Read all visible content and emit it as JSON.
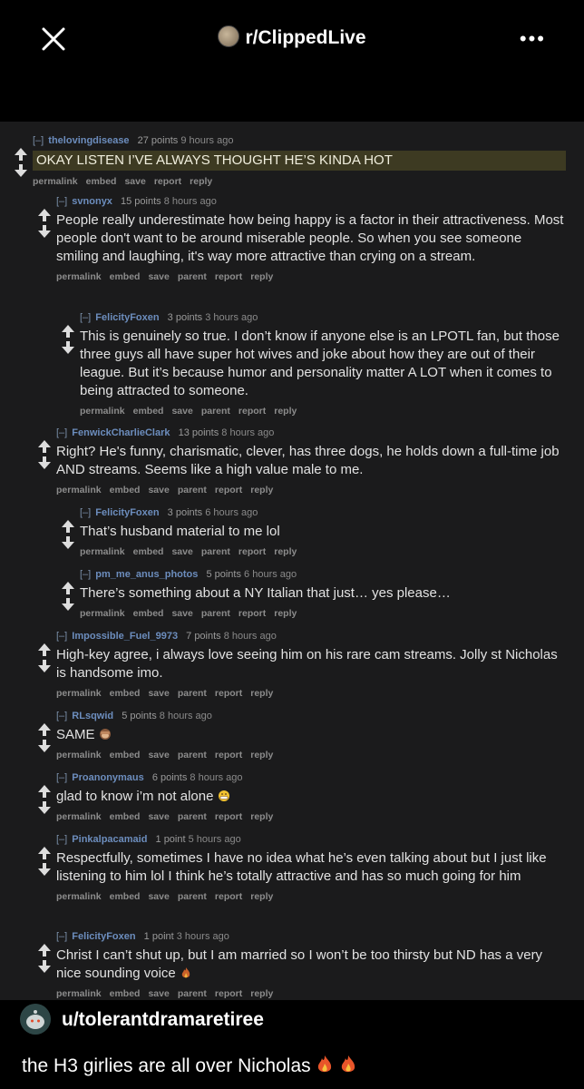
{
  "header": {
    "subreddit": "r/ClippedLive",
    "more": "•••"
  },
  "comments": [
    {
      "author": "thelovingdisease",
      "score": "27 points",
      "time": "9 hours ago",
      "text": "OKAY LISTEN I’VE ALWAYS THOUGHT HE’S KINDA HOT",
      "links": [
        "permalink",
        "embed",
        "save",
        "report",
        "reply"
      ]
    },
    {
      "author": "svnonyx",
      "score": "15 points",
      "time": "8 hours ago",
      "text": "People really underestimate how being happy is a factor in their attractiveness. Most people don't want to be around miserable people. So when you see someone smiling and laughing, it's way more attractive than crying on a stream.",
      "links": [
        "permalink",
        "embed",
        "save",
        "parent",
        "report",
        "reply"
      ]
    },
    {
      "author": "FelicityFoxen",
      "score": "3 points",
      "time": "3 hours ago",
      "text": "This is genuinely so true. I don’t know if anyone else is an LPOTL fan, but those three guys all have super hot wives and joke about how they are out of their league. But it’s because humor and personality matter A LOT when it comes to being attracted to someone.",
      "links": [
        "permalink",
        "embed",
        "save",
        "parent",
        "report",
        "reply"
      ]
    },
    {
      "author": "FenwickCharlieClark",
      "score": "13 points",
      "time": "8 hours ago",
      "text": "Right? He's funny, charismatic, clever, has three dogs, he holds down a full-time job AND streams. Seems like a high value male to me.",
      "links": [
        "permalink",
        "embed",
        "save",
        "parent",
        "report",
        "reply"
      ]
    },
    {
      "author": "FelicityFoxen",
      "score": "3 points",
      "time": "6 hours ago",
      "text": "That’s husband material to me lol",
      "links": [
        "permalink",
        "embed",
        "save",
        "parent",
        "report",
        "reply"
      ]
    },
    {
      "author": "pm_me_anus_photos",
      "score": "5 points",
      "time": "6 hours ago",
      "text": "There’s something about a NY Italian that just… yes please…",
      "links": [
        "permalink",
        "embed",
        "save",
        "parent",
        "report",
        "reply"
      ]
    },
    {
      "author": "Impossible_Fuel_9973",
      "score": "7 points",
      "time": "8 hours ago",
      "text": "High-key agree, i always love seeing him on his rare cam streams. Jolly st Nicholas is handsome imo.",
      "links": [
        "permalink",
        "embed",
        "save",
        "parent",
        "report",
        "reply"
      ]
    },
    {
      "author": "RLsqwid",
      "score": "5 points",
      "time": "8 hours ago",
      "text": "SAME",
      "links": [
        "permalink",
        "embed",
        "save",
        "parent",
        "report",
        "reply"
      ]
    },
    {
      "author": "Proanonymaus",
      "score": "6 points",
      "time": "8 hours ago",
      "text": "glad to know i’m not alone",
      "links": [
        "permalink",
        "embed",
        "save",
        "parent",
        "report",
        "reply"
      ]
    },
    {
      "author": "Pinkalpacamaid",
      "score": "1 point",
      "time": "5 hours ago",
      "text": "Respectfully, sometimes I have no idea what he’s even talking about but I just like listening to him lol I think he’s totally attractive and has so much going for him",
      "links": [
        "permalink",
        "embed",
        "save",
        "parent",
        "report",
        "reply"
      ]
    },
    {
      "author": "FelicityFoxen",
      "score": "1 point",
      "time": "3 hours ago",
      "text": "Christ I can’t shut up, but I am married so I won’t be too thirsty but ND has a very nice sounding voice",
      "links": [
        "permalink",
        "embed",
        "save",
        "parent",
        "report",
        "reply"
      ]
    }
  ],
  "toggle_label": "[–]",
  "post": {
    "username": "u/tolerantdramaretiree",
    "caption": "the H3 girlies are all over Nicholas"
  },
  "icons": {
    "close": "close-icon",
    "vote": "vote-arrows-icon",
    "fire": "fire-emoji",
    "monkey": "see-no-evil-monkey-emoji",
    "grin": "grimacing-emoji"
  }
}
